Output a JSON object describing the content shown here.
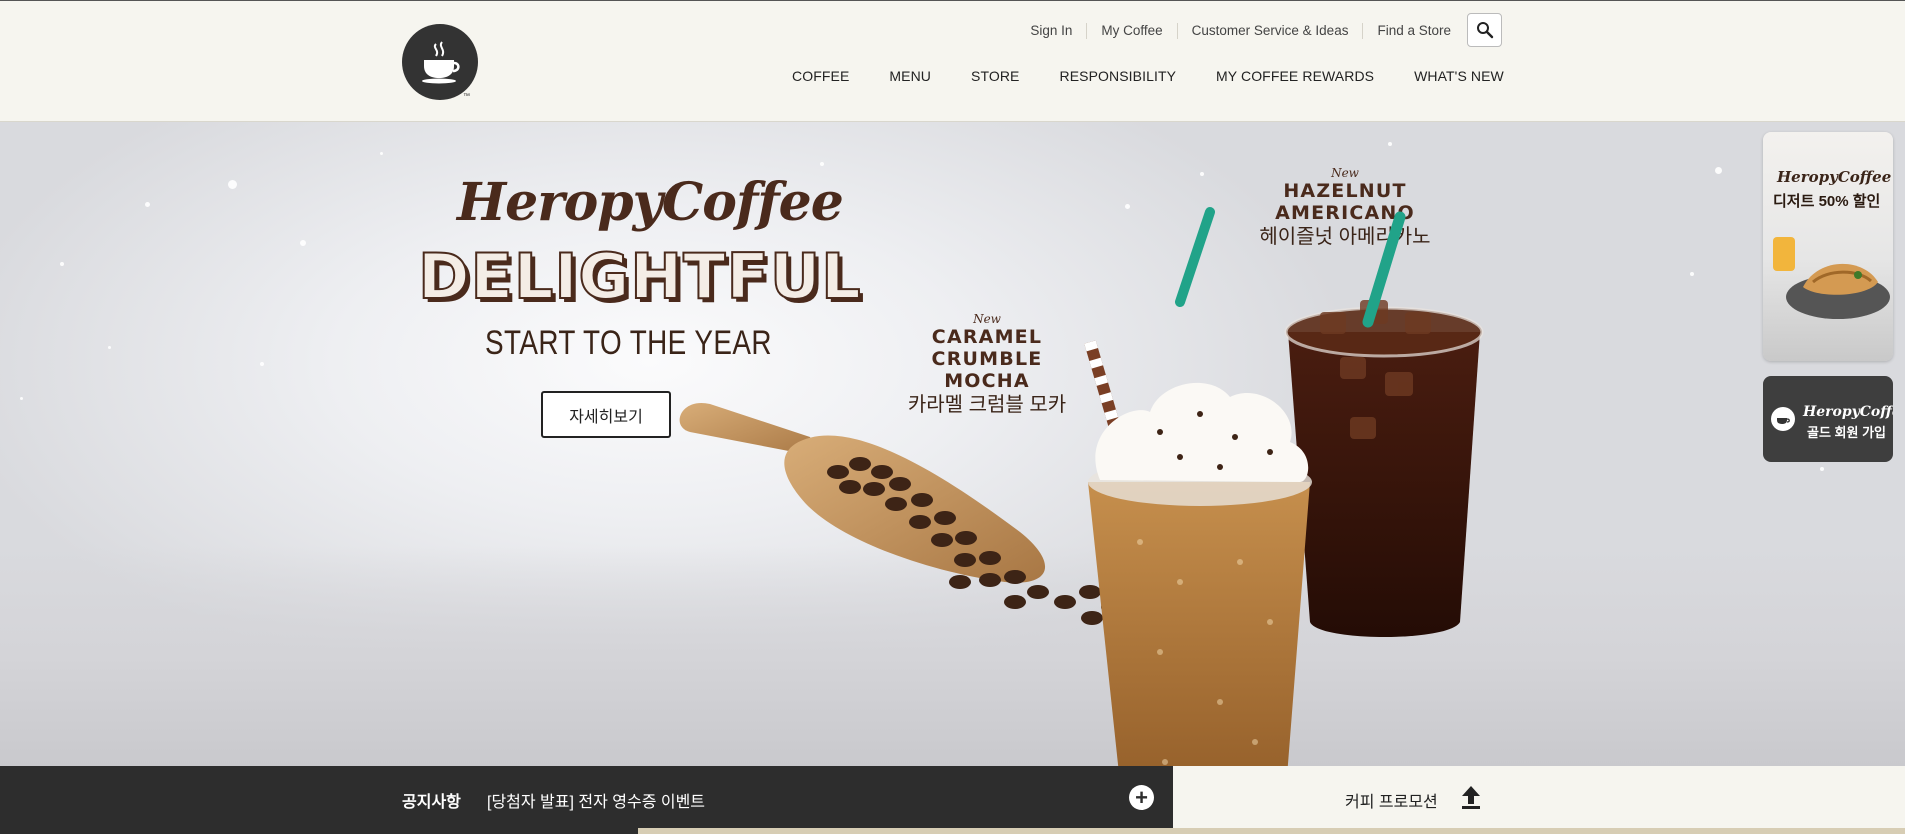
{
  "header": {
    "util_nav": [
      "Sign In",
      "My Coffee",
      "Customer Service & Ideas",
      "Find a Store"
    ],
    "main_nav": [
      "COFFEE",
      "MENU",
      "STORE",
      "RESPONSIBILITY",
      "MY COFFEE REWARDS",
      "WHAT'S NEW"
    ],
    "logo_tm": "™"
  },
  "hero": {
    "brand": "HeropyCoffee",
    "headline": "DELIGHTFUL",
    "tagline": "START TO THE YEAR",
    "button_label": "자세히보기",
    "products": [
      {
        "badge": "New",
        "name_line1": "CARAMEL",
        "name_line2": "CRUMBLE MOCHA",
        "name_ko": "카라멜 크럼블 모카"
      },
      {
        "badge": "New",
        "name_line1": "HAZELNUT",
        "name_line2": "AMERICANO",
        "name_ko": "헤이즐넛 아메리카노"
      }
    ]
  },
  "side_banners": {
    "dessert": {
      "brand": "HeropyCoffee",
      "text": "디저트 50% 할인"
    },
    "member": {
      "brand": "HeropyCoffee",
      "text": "골드 회원 가입"
    }
  },
  "notice": {
    "title": "공지사항",
    "text": "[당첨자 발표] 전자 영수증 이벤트",
    "more_icon": "plus-circle-icon"
  },
  "promotion": {
    "label": "커피 프로모션",
    "icon": "upload-arrow-icon"
  },
  "colors": {
    "header_bg": "#f6f5ef",
    "brand_brown": "#4a2a1c",
    "notice_bg": "#2d2d2d",
    "accent_tan": "#d7cdb4"
  }
}
